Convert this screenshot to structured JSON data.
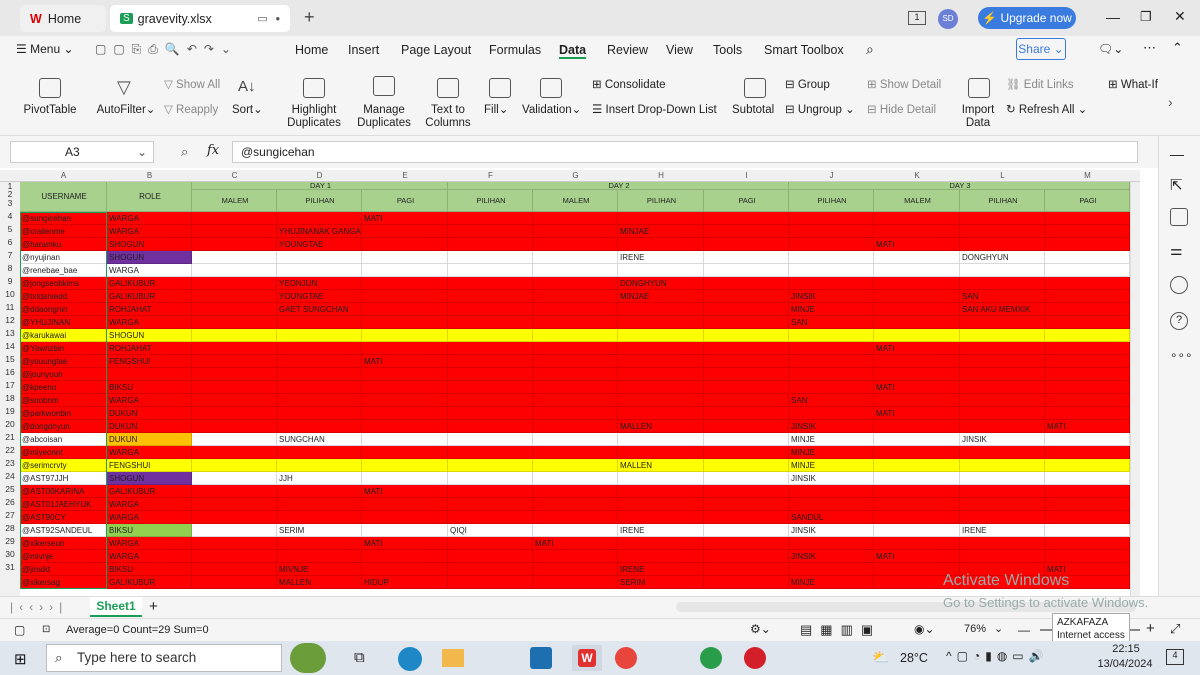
{
  "tabs": {
    "home": "Home",
    "file": "gravevity.xlsx",
    "plus": "+"
  },
  "upgrade": "Upgrade now",
  "avatar": "SD",
  "menu": {
    "label": "Menu",
    "items": [
      "Home",
      "Insert",
      "Page Layout",
      "Formulas",
      "Data",
      "Review",
      "View",
      "Tools",
      "Smart Toolbox"
    ],
    "share": "Share"
  },
  "ribbon": {
    "pivot": "PivotTable",
    "autofilter": "AutoFilter",
    "showall": "Show All",
    "reapply": "Reapply",
    "sort": "Sort",
    "highlight": "Highlight Duplicates",
    "manage": "Manage Duplicates",
    "t2c": "Text to Columns",
    "fill": "Fill",
    "validation": "Validation",
    "consolidate": "Consolidate",
    "dropdown": "Insert Drop-Down List",
    "subtotal": "Subtotal",
    "group": "Group",
    "ungroup": "Ungroup",
    "showdetail": "Show Detail",
    "hidedetail": "Hide Detail",
    "import": "Import Data",
    "editlinks": "Edit Links",
    "refresh": "Refresh All",
    "whatif": "What-If"
  },
  "formula": {
    "cellref": "A3",
    "fx": "fx",
    "value": "@sungicehan"
  },
  "columns": [
    "A",
    "B",
    "C",
    "D",
    "E",
    "F",
    "G",
    "H",
    "I",
    "J",
    "K",
    "L",
    "M"
  ],
  "header": {
    "username": "USERNAME",
    "role": "ROLE",
    "day1": "DAY 1",
    "day2": "DAY 2",
    "day3": "DAY 3",
    "sub": [
      "MALEM",
      "PILIHAN",
      "PAGI",
      "PILIHAN",
      "MALEM",
      "PILIHAN",
      "PAGI",
      "PILIHAN",
      "MALEM",
      "PILIHAN",
      "PAGI"
    ]
  },
  "colors": {
    "red": "#ff0000",
    "yellow": "#ffff00",
    "green": "#a9d18e",
    "white": "#ffffff",
    "purple": "#7030a0",
    "orange": "#ffc000",
    "lightgreen": "#92d050"
  },
  "rows": [
    {
      "n": 3,
      "bg": "red",
      "user": "@sungicehan",
      "role": "WARGA",
      "cells": {
        "E": "MATI"
      }
    },
    {
      "n": 4,
      "bg": "red",
      "user": "@crailenme",
      "role": "WARGA",
      "cells": {
        "D": "YHUJINANAK GANGANJI",
        "H": "MINJAE"
      }
    },
    {
      "n": 5,
      "bg": "red",
      "user": "@haramku",
      "role": "SHOGUN",
      "cells": {
        "D": "YOUNGTAE",
        "K": "MATI"
      }
    },
    {
      "n": 6,
      "bg": "white",
      "user": "@nyujinan",
      "role": "SHOGUN",
      "roleBg": "purple",
      "cells": {
        "H": "IRENE",
        "L": "DONGHYUN"
      }
    },
    {
      "n": 7,
      "bg": "white",
      "user": "@renebae_bae",
      "role": "WARGA",
      "cells": {}
    },
    {
      "n": 8,
      "bg": "red",
      "user": "@jongseobkims",
      "role": "GALIKUBUR",
      "cells": {
        "D": "YEONJUN",
        "H": "DONGHYUN"
      }
    },
    {
      "n": 9,
      "bg": "red",
      "user": "@txtdaniedd",
      "role": "GALIKUBUR",
      "cells": {
        "D": "YOUNGTAE",
        "H": "MINJAE",
        "J": "JINSIK",
        "L": "SAN"
      }
    },
    {
      "n": 10,
      "bg": "red",
      "user": "@ddaongnin",
      "role": "ROHJAHAT",
      "cells": {
        "D": "GAET SUNGCHAN",
        "J": "MINJE",
        "L": "SAN AKU MEMXIK"
      }
    },
    {
      "n": 11,
      "bg": "red",
      "user": "@YHUJINAN",
      "role": "WARGA",
      "cells": {
        "J": "SAN"
      }
    },
    {
      "n": 12,
      "bg": "yellow",
      "user": "@karukawai",
      "role": "SHOGUN",
      "cells": {}
    },
    {
      "n": 13,
      "bg": "red",
      "user": "@Yawnzbin",
      "role": "ROHJAHAT",
      "cells": {
        "K": "MATI"
      }
    },
    {
      "n": 14,
      "bg": "red",
      "user": "@youungtae",
      "role": "FENGSHUI",
      "cells": {
        "E": "MATI"
      }
    },
    {
      "n": 15,
      "bg": "red",
      "user": "@jounyoun",
      "role": "",
      "cells": {}
    },
    {
      "n": 16,
      "bg": "red",
      "user": "@kpeeno",
      "role": "BIKSU",
      "cells": {
        "K": "MATI"
      }
    },
    {
      "n": 17,
      "bg": "red",
      "user": "@soobnm",
      "role": "WARGA",
      "cells": {
        "J": "SAN"
      }
    },
    {
      "n": 18,
      "bg": "red",
      "user": "@parkwonbin",
      "role": "DUKUN",
      "cells": {
        "K": "MATI"
      }
    },
    {
      "n": 19,
      "bg": "red",
      "user": "@dongdnyun",
      "role": "DUKUN",
      "cells": {
        "H": "MALLEN",
        "J": "JINSIK",
        "M": "MATI"
      }
    },
    {
      "n": 20,
      "bg": "white",
      "user": "@abcoisan",
      "role": "DUKUN",
      "roleBg": "orange",
      "cells": {
        "D": "SUNGCHAN",
        "J": "MINJE",
        "L": "JINSIK"
      }
    },
    {
      "n": 21,
      "bg": "red",
      "user": "@miyeonnt",
      "role": "WARGA",
      "cells": {
        "J": "MINJE"
      }
    },
    {
      "n": 22,
      "bg": "yellow",
      "user": "@serimcrvty",
      "role": "FENGSHUI",
      "cells": {
        "H": "MALLEN",
        "J": "MINJE"
      }
    },
    {
      "n": 23,
      "bg": "white",
      "user": "@AST97JJH",
      "role": "SHOGUN",
      "roleBg": "purple",
      "cells": {
        "D": "JJH",
        "J": "JINSIK"
      }
    },
    {
      "n": 24,
      "bg": "red",
      "user": "@AST00KARINA",
      "role": "GALIKUBUR",
      "cells": {
        "E": "MATI"
      }
    },
    {
      "n": 25,
      "bg": "red",
      "user": "@AST01JAEHYUK",
      "role": "WARGA",
      "cells": {}
    },
    {
      "n": 26,
      "bg": "red",
      "user": "@AST90CY",
      "role": "WARGA",
      "cells": {
        "J": "SANDUL"
      }
    },
    {
      "n": 27,
      "bg": "white",
      "user": "@AST92SANDEUL",
      "role": "BIKSU",
      "roleBg": "lightgreen",
      "cells": {
        "D": "SERIM",
        "F": "QIQI",
        "H": "IRENE",
        "J": "JINSIK",
        "L": "IRENE"
      }
    },
    {
      "n": 28,
      "bg": "red",
      "user": "@xikerseun",
      "role": "WARGA",
      "cells": {
        "E": "MATI",
        "G": "MATI"
      }
    },
    {
      "n": 29,
      "bg": "red",
      "user": "@mivnje",
      "role": "WARGA",
      "cells": {
        "J": "JINSIK",
        "K": "MATI"
      }
    },
    {
      "n": 30,
      "bg": "red",
      "user": "@jinsikt",
      "role": "BIKSU",
      "cells": {
        "D": "MIVNJE",
        "H": "IRENE",
        "M": "MATI"
      }
    },
    {
      "n": 31,
      "bg": "red",
      "user": "@xikersag",
      "role": "GALIKUBUR",
      "cells": {
        "D": "MALLEN",
        "E": "HIDUP",
        "H": "SERIM",
        "J": "MINJE"
      }
    }
  ],
  "sheet": {
    "name": "Sheet1"
  },
  "status": {
    "stats": "Average=0  Count=29  Sum=0",
    "zoom": "76%"
  },
  "watermark": {
    "line1": "Activate Windows",
    "line2": "Go to Settings to activate Windows."
  },
  "tooltip": {
    "line1": "AZKAFAZA",
    "line2": "Internet access"
  },
  "taskbar": {
    "search": "Type here to search",
    "temp": "28°C",
    "time": "22:15",
    "date": "13/04/2024",
    "notif": "4"
  }
}
